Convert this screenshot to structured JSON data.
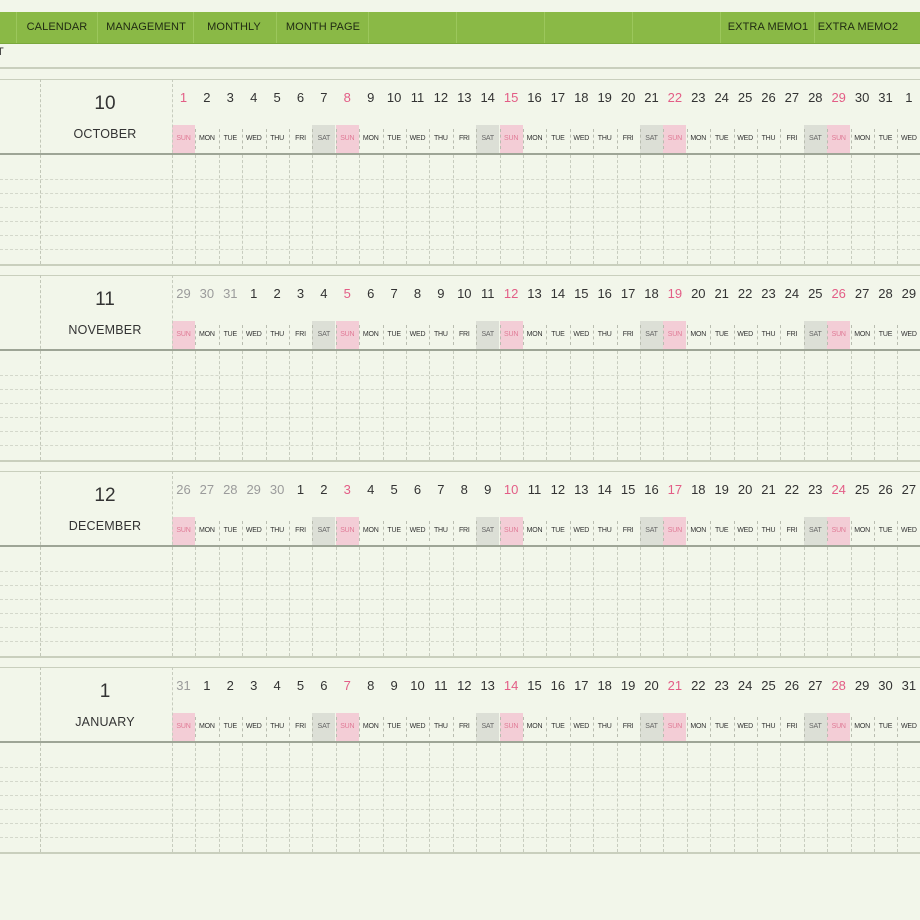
{
  "nav": {
    "tabs": [
      {
        "label": "CALENDAR"
      },
      {
        "label": "MANAGEMENT"
      },
      {
        "label": "MONTHLY"
      },
      {
        "label": "MONTH PAGE"
      },
      {
        "label": ""
      },
      {
        "label": ""
      },
      {
        "label": ""
      },
      {
        "label": ""
      },
      {
        "label": "EXTRA MEMO1"
      },
      {
        "label": "EXTRA MEMO2"
      }
    ]
  },
  "subbar": {
    "text": "T"
  },
  "dow_labels": [
    "SUN",
    "MON",
    "TUE",
    "WED",
    "THU",
    "FRI",
    "SAT",
    "SUN",
    "MON",
    "TUE",
    "WED",
    "THU",
    "FRI",
    "SAT",
    "SUN",
    "MON",
    "TUE",
    "WED",
    "THU",
    "FRI",
    "SAT",
    "SUN",
    "MON",
    "TUE",
    "WED",
    "THU",
    "FRI",
    "SAT",
    "SUN",
    "MON",
    "TUE",
    "WED"
  ],
  "months": [
    {
      "number": "10",
      "name": "OCTOBER",
      "days": [
        "1",
        "2",
        "3",
        "4",
        "5",
        "6",
        "7",
        "8",
        "9",
        "10",
        "11",
        "12",
        "13",
        "14",
        "15",
        "16",
        "17",
        "18",
        "19",
        "20",
        "21",
        "22",
        "23",
        "24",
        "25",
        "26",
        "27",
        "28",
        "29",
        "30",
        "31",
        "1"
      ],
      "other": [
        false,
        false,
        false,
        false,
        false,
        false,
        false,
        false,
        false,
        false,
        false,
        false,
        false,
        false,
        false,
        false,
        false,
        false,
        false,
        false,
        false,
        false,
        false,
        false,
        false,
        false,
        false,
        false,
        false,
        false,
        false,
        false
      ]
    },
    {
      "number": "11",
      "name": "NOVEMBER",
      "days": [
        "29",
        "30",
        "31",
        "1",
        "2",
        "3",
        "4",
        "5",
        "6",
        "7",
        "8",
        "9",
        "10",
        "11",
        "12",
        "13",
        "14",
        "15",
        "16",
        "17",
        "18",
        "19",
        "20",
        "21",
        "22",
        "23",
        "24",
        "25",
        "26",
        "27",
        "28",
        "29"
      ],
      "other": [
        true,
        true,
        true,
        false,
        false,
        false,
        false,
        false,
        false,
        false,
        false,
        false,
        false,
        false,
        false,
        false,
        false,
        false,
        false,
        false,
        false,
        false,
        false,
        false,
        false,
        false,
        false,
        false,
        false,
        false,
        false,
        false
      ]
    },
    {
      "number": "12",
      "name": "DECEMBER",
      "days": [
        "26",
        "27",
        "28",
        "29",
        "30",
        "1",
        "2",
        "3",
        "4",
        "5",
        "6",
        "7",
        "8",
        "9",
        "10",
        "11",
        "12",
        "13",
        "14",
        "15",
        "16",
        "17",
        "18",
        "19",
        "20",
        "21",
        "22",
        "23",
        "24",
        "25",
        "26",
        "27"
      ],
      "other": [
        true,
        true,
        true,
        true,
        true,
        false,
        false,
        false,
        false,
        false,
        false,
        false,
        false,
        false,
        false,
        false,
        false,
        false,
        false,
        false,
        false,
        false,
        false,
        false,
        false,
        false,
        false,
        false,
        false,
        false,
        false,
        false
      ]
    },
    {
      "number": "1",
      "name": "JANUARY",
      "days": [
        "31",
        "1",
        "2",
        "3",
        "4",
        "5",
        "6",
        "7",
        "8",
        "9",
        "10",
        "11",
        "12",
        "13",
        "14",
        "15",
        "16",
        "17",
        "18",
        "19",
        "20",
        "21",
        "22",
        "23",
        "24",
        "25",
        "26",
        "27",
        "28",
        "29",
        "30",
        "31"
      ],
      "other": [
        true,
        false,
        false,
        false,
        false,
        false,
        false,
        false,
        false,
        false,
        false,
        false,
        false,
        false,
        false,
        false,
        false,
        false,
        false,
        false,
        false,
        false,
        false,
        false,
        false,
        false,
        false,
        false,
        false,
        false,
        false,
        false
      ]
    }
  ],
  "colors": {
    "accent": "#8ab946",
    "sunday": "#e35d86",
    "sunday_bg": "#f3cdd6",
    "saturday_bg": "#dcdfd6",
    "background": "#f2f6ea"
  }
}
